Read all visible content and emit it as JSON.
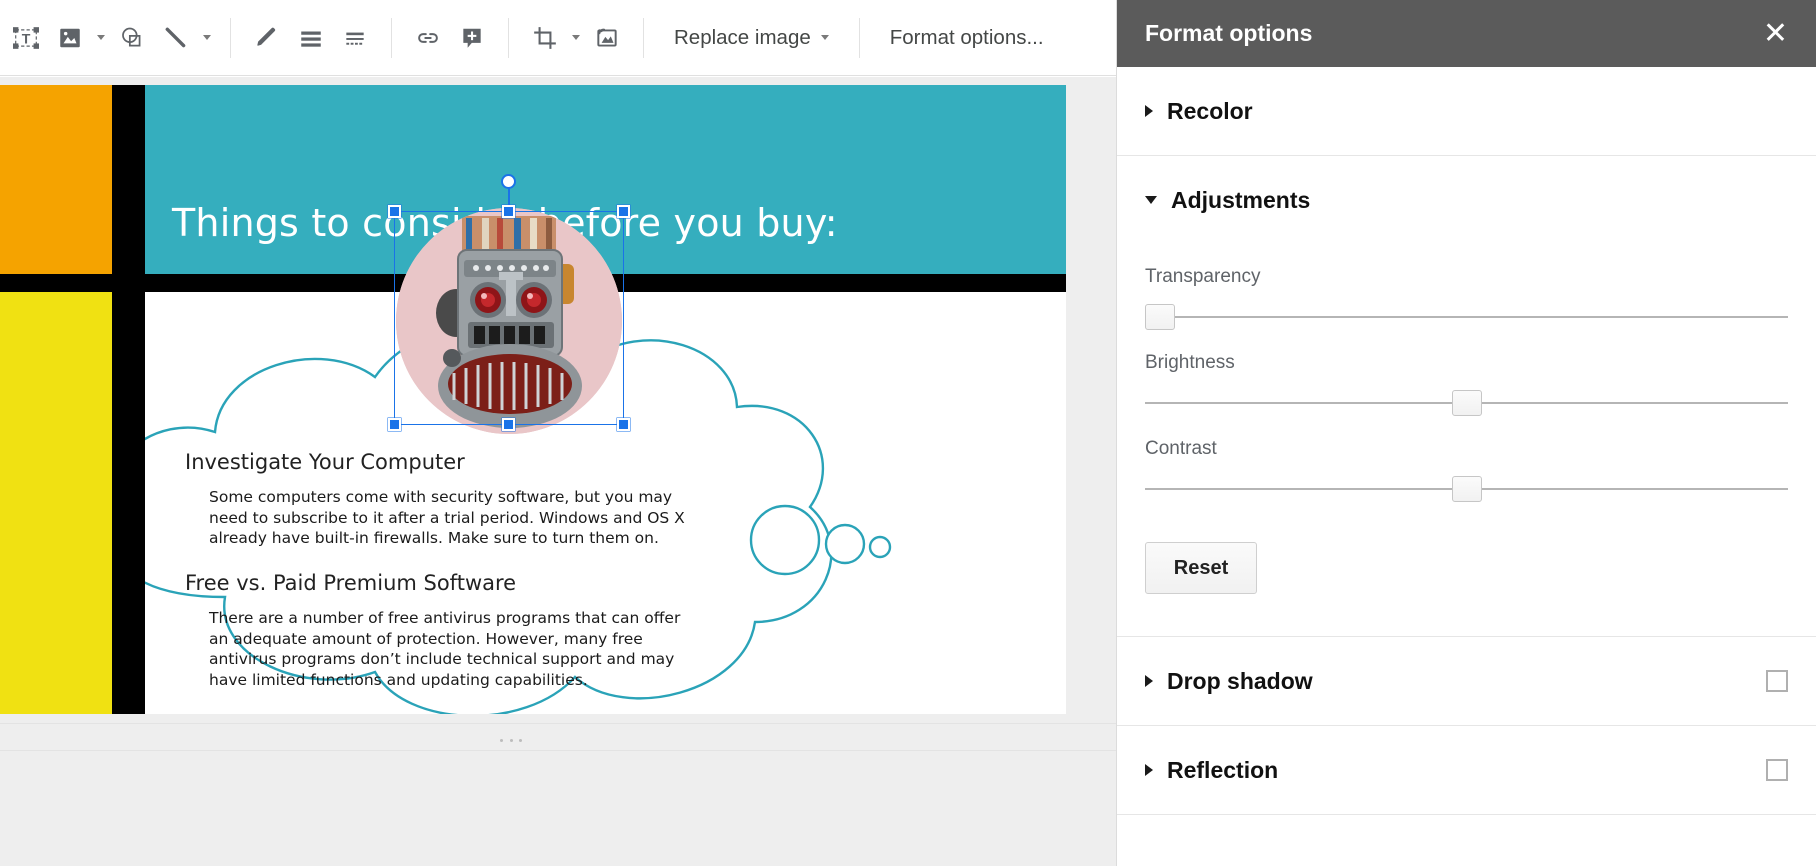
{
  "toolbar": {
    "icons": [
      {
        "name": "text-box-icon",
        "title": "Text box"
      },
      {
        "name": "image-icon",
        "title": "Insert image"
      },
      {
        "name": "shape-icon",
        "title": "Shape"
      },
      {
        "name": "line-icon",
        "title": "Line"
      },
      {
        "name": "pen-icon",
        "title": "Pen / scribble"
      },
      {
        "name": "fill-color-icon",
        "title": "Fill color"
      },
      {
        "name": "border-dash-icon",
        "title": "Border dash"
      },
      {
        "name": "link-icon",
        "title": "Insert link"
      },
      {
        "name": "comment-icon",
        "title": "Add comment"
      },
      {
        "name": "crop-icon",
        "title": "Crop image"
      },
      {
        "name": "mask-image-icon",
        "title": "Mask image"
      }
    ],
    "replace_image_label": "Replace image",
    "format_options_label": "Format options...",
    "collapse_label": "collapse-toolbar-icon"
  },
  "slide": {
    "title": "Things to consider before you buy:",
    "blocks": [
      {
        "name": "orange-block",
        "color": "#f5a300"
      },
      {
        "name": "yellow-block",
        "color": "#f0e112"
      },
      {
        "name": "teal-header-block",
        "color": "#35aebe"
      },
      {
        "name": "black-divider",
        "color": "#000000"
      }
    ],
    "content": [
      {
        "heading": "Investigate Your Computer",
        "paragraph": "Some computers come with security software, but you may need to subscribe to it after a trial period. Windows and OS X already have built-in firewalls. Make sure to turn them on."
      },
      {
        "heading": "Free vs. Paid Premium Software",
        "paragraph": "There are a number of free antivirus programs that can offer an adequate amount of protection. However, many free antivirus programs don’t include technical support and may have limited functions and updating capabilities."
      }
    ],
    "selected_object": "robot-image",
    "cloud_outline_color": "#2aa3b8"
  },
  "panel": {
    "title": "Format options",
    "close_label": "✕",
    "sections": [
      {
        "id": "recolor",
        "label": "Recolor",
        "expanded": false,
        "has_checkbox": false
      },
      {
        "id": "adjustments",
        "label": "Adjustments",
        "expanded": true,
        "has_checkbox": false
      },
      {
        "id": "drop_shadow",
        "label": "Drop shadow",
        "expanded": false,
        "has_checkbox": true,
        "checked": false
      },
      {
        "id": "reflection",
        "label": "Reflection",
        "expanded": false,
        "has_checkbox": true,
        "checked": false
      }
    ],
    "adjustments": {
      "sliders": [
        {
          "id": "transparency",
          "label": "Transparency",
          "percent": 0
        },
        {
          "id": "brightness",
          "label": "Brightness",
          "percent": 50
        },
        {
          "id": "contrast",
          "label": "Contrast",
          "percent": 50
        }
      ],
      "reset_label": "Reset"
    }
  },
  "colors": {
    "accent_blue": "#1a73e8",
    "panel_header": "#5b5b5b",
    "teal": "#35aebe",
    "orange": "#f5a300",
    "yellow": "#f0e112"
  }
}
